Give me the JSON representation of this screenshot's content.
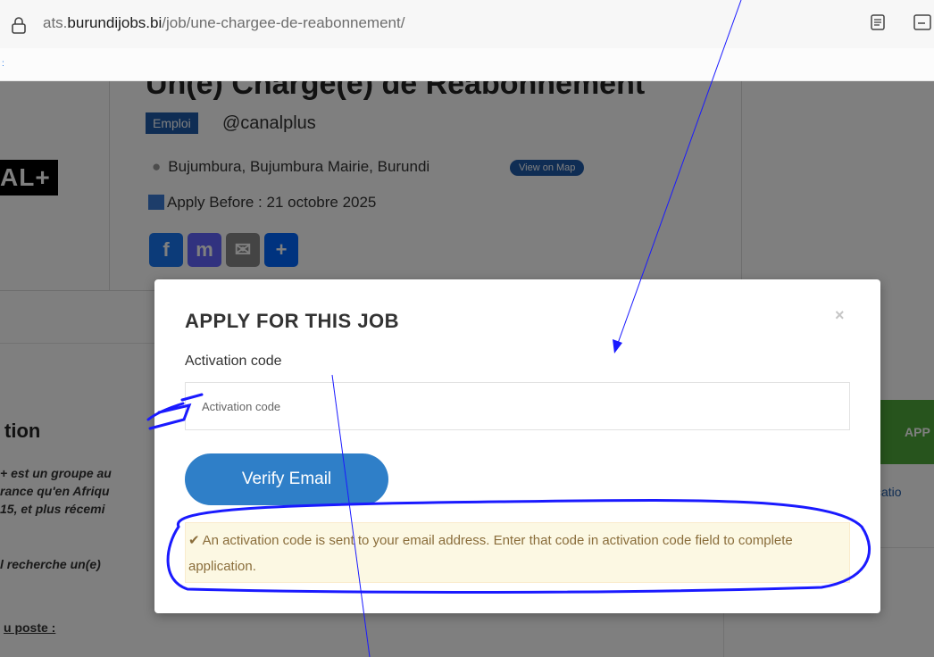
{
  "browser": {
    "url_prefix": "ats.",
    "url_domain": "burundijobs.bi",
    "url_path": "/job/une-chargee-de-reabonnement/"
  },
  "job": {
    "title": "Un(e) Chargé(e) de Réabonnement",
    "badge": "Emploi",
    "company": "@canalplus",
    "logo_text": "AL+",
    "location": "Bujumbura, Bujumbura Mairie, Burundi",
    "map_button": "View on Map",
    "deadline": "Apply Before : 21 octobre 2025",
    "share": [
      {
        "icon": "facebook-icon",
        "glyph": "f",
        "color": "#1877f2"
      },
      {
        "icon": "mastodon-icon",
        "glyph": "m",
        "color": "#6364ff"
      },
      {
        "icon": "email-icon",
        "glyph": "✉",
        "color": "#888888"
      },
      {
        "icon": "share-plus-icon",
        "glyph": "+",
        "color": "#0166ff"
      }
    ],
    "description_heading": "tion",
    "description_lines": [
      "+ est un groupe au",
      "rance qu'en Afriqu",
      "15, et plus récemi"
    ],
    "search_line": "l recherche un(e)",
    "poste_heading": "u poste :",
    "apply_button": "APP",
    "application_link": "plicatio"
  },
  "modal": {
    "title": "APPLY FOR THIS JOB",
    "close": "×",
    "field_label": "Activation code",
    "input_placeholder": "Activation code",
    "input_value": "",
    "verify_button": "Verify Email",
    "alert_text": "An activation code is sent to your email address. Enter that code in activation code field to complete application."
  },
  "colors": {
    "overlay": "rgba(0,0,0,0.5)",
    "verify_button": "#2f7fc8",
    "alert_bg": "#fcf8e3",
    "annotation": "#1a1aff"
  }
}
